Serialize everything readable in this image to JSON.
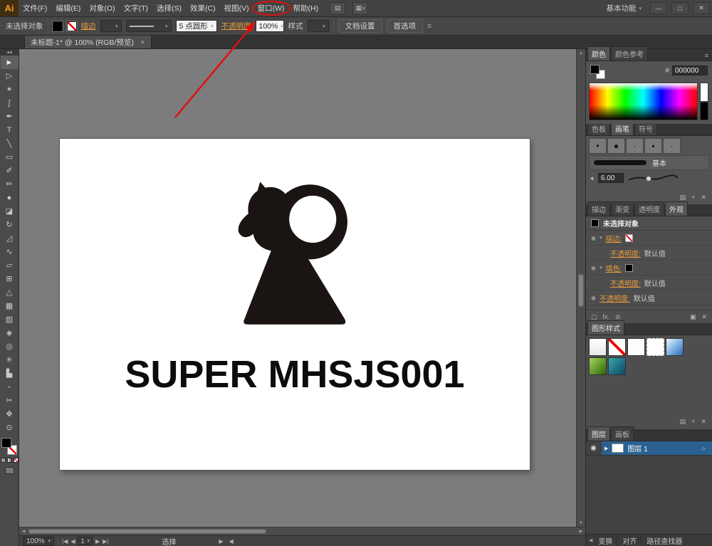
{
  "window": {
    "mode_label": "基本功能",
    "minimize": "—",
    "restore": "□",
    "close": "✕"
  },
  "menubar": {
    "logo_text": "Ai",
    "items": [
      "文件(F)",
      "编辑(E)",
      "对象(O)",
      "文字(T)",
      "选择(S)",
      "效果(C)",
      "视图(V)",
      "窗口(W)",
      "帮助(H)"
    ],
    "highlighted_item": "窗口(W)"
  },
  "controlbar": {
    "status_label": "未选择对象",
    "stroke_link": "描边",
    "brush_preset": "5 点圆形",
    "opacity_link": "不透明度",
    "opacity_value": "100%",
    "style_label": "样式",
    "document_setup": "文档设置",
    "preferences": "首选项"
  },
  "document_tab": {
    "title": "未标题-1* @ 100% (RGB/预览)"
  },
  "toolbar": {
    "tools": [
      {
        "name": "selection-tool",
        "glyph": "►"
      },
      {
        "name": "direct-selection-tool",
        "glyph": "▷"
      },
      {
        "name": "magic-wand-tool",
        "glyph": "✶"
      },
      {
        "name": "lasso-tool",
        "glyph": "ʃ"
      },
      {
        "name": "pen-tool",
        "glyph": "✒"
      },
      {
        "name": "type-tool",
        "glyph": "T"
      },
      {
        "name": "line-tool",
        "glyph": "╲"
      },
      {
        "name": "rectangle-tool",
        "glyph": "▭"
      },
      {
        "name": "paintbrush-tool",
        "glyph": "✐"
      },
      {
        "name": "pencil-tool",
        "glyph": "✏"
      },
      {
        "name": "blob-brush-tool",
        "glyph": "●"
      },
      {
        "name": "eraser-tool",
        "glyph": "◪"
      },
      {
        "name": "rotate-tool",
        "glyph": "↻"
      },
      {
        "name": "scale-tool",
        "glyph": "◿"
      },
      {
        "name": "width-tool",
        "glyph": "∿"
      },
      {
        "name": "free-transform-tool",
        "glyph": "▱"
      },
      {
        "name": "shape-builder-tool",
        "glyph": "⊞"
      },
      {
        "name": "perspective-grid-tool",
        "glyph": "△"
      },
      {
        "name": "mesh-tool",
        "glyph": "▦"
      },
      {
        "name": "gradient-tool",
        "glyph": "▥"
      },
      {
        "name": "eyedropper-tool",
        "glyph": "◈"
      },
      {
        "name": "blend-tool",
        "glyph": "◎"
      },
      {
        "name": "symbol-sprayer-tool",
        "glyph": "✳"
      },
      {
        "name": "column-graph-tool",
        "glyph": "▙"
      },
      {
        "name": "artboard-tool",
        "glyph": "▫"
      },
      {
        "name": "slice-tool",
        "glyph": "✂"
      },
      {
        "name": "hand-tool",
        "glyph": "✥"
      },
      {
        "name": "zoom-tool",
        "glyph": "⊙"
      }
    ]
  },
  "canvas": {
    "artboard_text": "SUPER MHSJS001"
  },
  "dock": {
    "color_panel": {
      "tabs": [
        "颜色",
        "颜色参考"
      ],
      "hex_label": "#",
      "hex_value": "000000"
    },
    "brush_panel": {
      "tabs": [
        "色板",
        "画笔",
        "符号"
      ],
      "cells": [
        "•",
        "●",
        "·",
        "▪",
        "·"
      ],
      "basic_label": "基本",
      "size_value": "6.00"
    },
    "appearance_panel": {
      "tabs": [
        "描边",
        "渐变",
        "透明度",
        "外观"
      ],
      "header": "未选择对象",
      "rows": [
        {
          "label": "描边:",
          "swatch": "none",
          "value": ""
        },
        {
          "label": "不透明度:",
          "swatch": "",
          "value": "默认值"
        },
        {
          "label": "填色:",
          "swatch": "black",
          "value": ""
        },
        {
          "label": "不透明度:",
          "swatch": "",
          "value": "默认值"
        },
        {
          "label": "不透明度:",
          "swatch": "",
          "value": "默认值"
        }
      ]
    },
    "styles_panel": {
      "tab": "图形样式",
      "styles": [
        "default",
        "none",
        "white",
        "dashed",
        "blue",
        "green",
        "teal"
      ]
    },
    "layers_panel": {
      "tabs": [
        "图层",
        "画板"
      ],
      "layer_name": "图层 1"
    },
    "bottom_tabs": [
      "变换",
      "对齐",
      "路径查找器"
    ]
  },
  "statusbar": {
    "zoom": "100%",
    "artboard": "1",
    "status": "选择",
    "nav": [
      "|◀",
      "◀",
      "▶",
      "▶|"
    ]
  },
  "icons": {
    "dropdown": "▾",
    "menu": "≡",
    "bridge": "▤",
    "arrange": "▦",
    "scroll_up": "▲",
    "scroll_down": "▼",
    "scroll_left": "◀",
    "scroll_right": "▶",
    "eye": "◉",
    "expand": "▶",
    "target": "○",
    "close_tab": "✕",
    "trash": "✕",
    "new": "+",
    "libraries": "▤",
    "fx": "fx.",
    "clear": "⊘",
    "duplicate": "▣",
    "stroke_box": "▢",
    "speaker": "◄",
    "collapse": "◀◀"
  },
  "colors": {
    "accent_orange": "#e89a3c",
    "annotation_red": "#e01010",
    "selection_blue": "#2b6191",
    "hex_shown": "#000000"
  }
}
